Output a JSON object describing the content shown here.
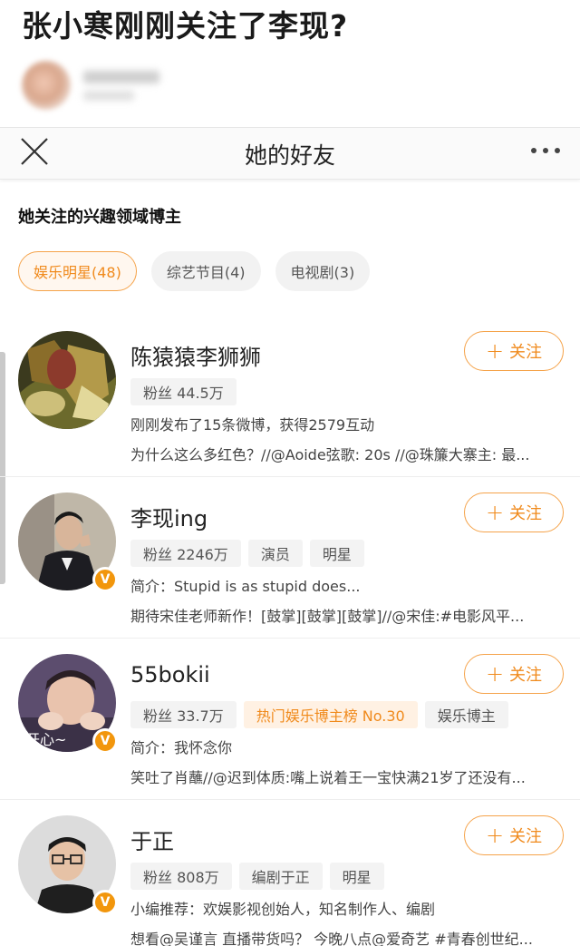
{
  "article": {
    "title": "张小寒刚刚关注了李现?"
  },
  "sheet": {
    "title": "她的好友"
  },
  "section": {
    "title": "她关注的兴趣领域博主"
  },
  "chips": [
    {
      "label": "娱乐明星(48)"
    },
    {
      "label": "综艺节目(4)"
    },
    {
      "label": "电视剧(3)"
    }
  ],
  "follow_label": "关注",
  "colors": {
    "accent": "#f08a1c",
    "verified": "#f2960c"
  },
  "users": [
    {
      "name": "陈猿猿李狮狮",
      "tags": [
        "粉丝 44.5万"
      ],
      "line1": "刚刚发布了15条微博，获得2579互动",
      "line2": "为什么这么多红色？//@Aoide弦歌: 20s //@珠簾大寨主: 最..."
    },
    {
      "name": "李现ing",
      "tags": [
        "粉丝 2246万",
        "演员",
        "明星"
      ],
      "line1": "简介：Stupid is as stupid does...",
      "line2": "期待宋佳老师新作！[鼓掌][鼓掌][鼓掌]//@宋佳:#电影风平..."
    },
    {
      "name": "55bokii",
      "tags": [
        "粉丝 33.7万",
        "热门娱乐博主榜 No.30",
        "娱乐博主"
      ],
      "line1": "简介：我怀念你",
      "line2": "笑吐了肖蘸//@迟到体质:嘴上说着王一宝快满21岁了还没有..."
    },
    {
      "name": "于正",
      "tags": [
        "粉丝 808万",
        "编剧于正",
        "明星"
      ],
      "line1": "小编推荐：欢娱影视创始人，知名制作人、编剧",
      "line2": "想看@吴谨言 直播带货吗？ 今晚八点@爱奇艺 #青春创世纪..."
    }
  ]
}
